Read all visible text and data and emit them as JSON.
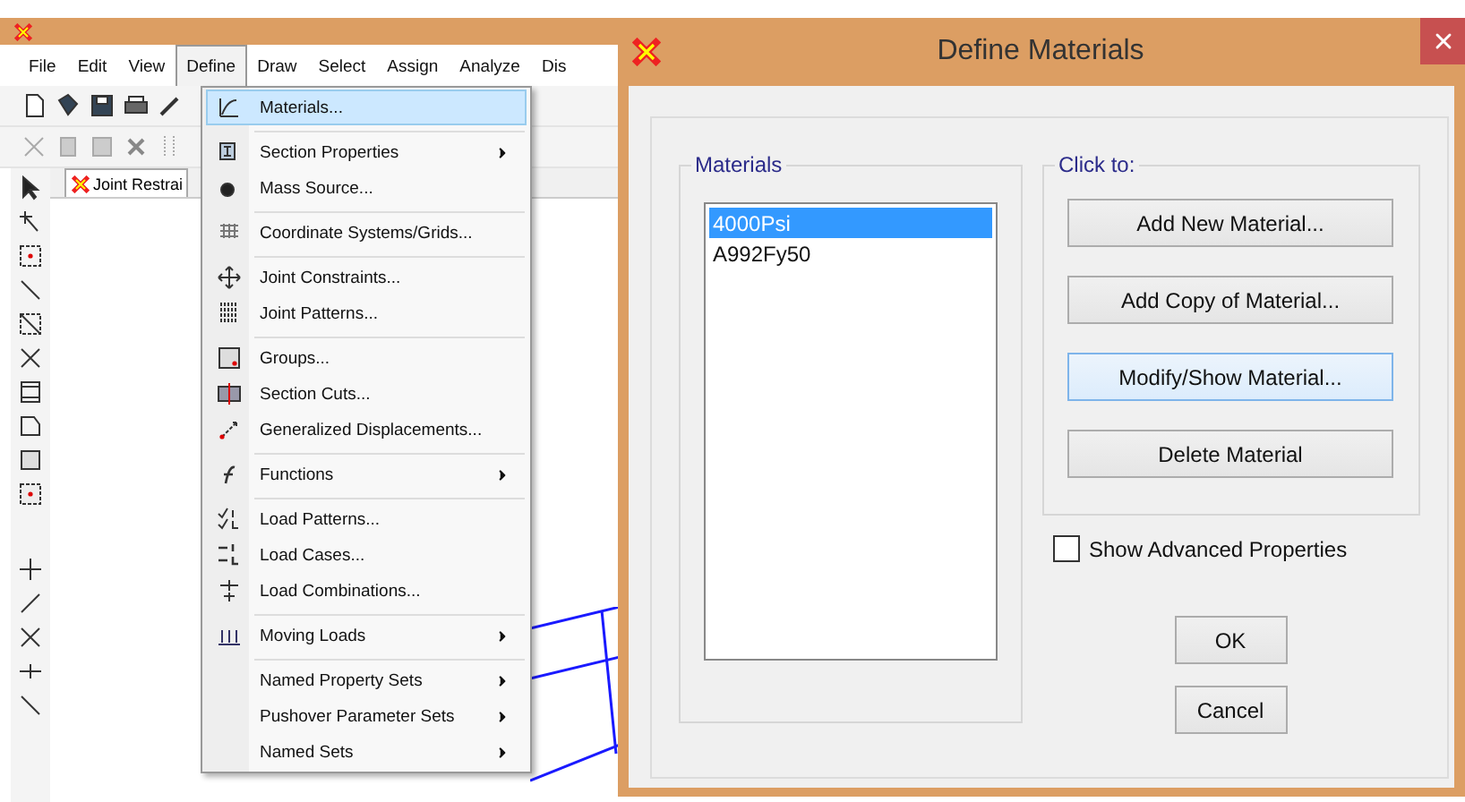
{
  "app": {
    "menu_bar": [
      {
        "label": "File",
        "selected": false
      },
      {
        "label": "Edit",
        "selected": false
      },
      {
        "label": "View",
        "selected": false
      },
      {
        "label": "Define",
        "selected": true
      },
      {
        "label": "Draw",
        "selected": false
      },
      {
        "label": "Select",
        "selected": false
      },
      {
        "label": "Assign",
        "selected": false
      },
      {
        "label": "Analyze",
        "selected": false
      },
      {
        "label": "Dis",
        "selected": false
      }
    ],
    "tab": {
      "label": "Joint Restrai"
    }
  },
  "define_menu": [
    {
      "label": "Materials...",
      "selected": true,
      "submenu": false,
      "separator_before": false
    },
    {
      "label": "Section Properties",
      "selected": false,
      "submenu": true,
      "separator_before": true
    },
    {
      "label": "Mass Source...",
      "selected": false,
      "submenu": false,
      "separator_before": false
    },
    {
      "label": "Coordinate Systems/Grids...",
      "selected": false,
      "submenu": false,
      "separator_before": true
    },
    {
      "label": "Joint Constraints...",
      "selected": false,
      "submenu": false,
      "separator_before": true
    },
    {
      "label": "Joint Patterns...",
      "selected": false,
      "submenu": false,
      "separator_before": false
    },
    {
      "label": "Groups...",
      "selected": false,
      "submenu": false,
      "separator_before": true
    },
    {
      "label": "Section Cuts...",
      "selected": false,
      "submenu": false,
      "separator_before": false
    },
    {
      "label": "Generalized Displacements...",
      "selected": false,
      "submenu": false,
      "separator_before": false
    },
    {
      "label": "Functions",
      "selected": false,
      "submenu": true,
      "separator_before": true
    },
    {
      "label": "Load Patterns...",
      "selected": false,
      "submenu": false,
      "separator_before": true
    },
    {
      "label": "Load Cases...",
      "selected": false,
      "submenu": false,
      "separator_before": false
    },
    {
      "label": "Load Combinations...",
      "selected": false,
      "submenu": false,
      "separator_before": false
    },
    {
      "label": "Moving Loads",
      "selected": false,
      "submenu": true,
      "separator_before": true
    },
    {
      "label": "Named Property Sets",
      "selected": false,
      "submenu": true,
      "separator_before": true
    },
    {
      "label": "Pushover Parameter Sets",
      "selected": false,
      "submenu": true,
      "separator_before": false
    },
    {
      "label": "Named Sets",
      "selected": false,
      "submenu": true,
      "separator_before": false
    }
  ],
  "dialog": {
    "title": "Define Materials",
    "materials_group": {
      "title": "Materials",
      "items": [
        {
          "name": "4000Psi",
          "selected": true
        },
        {
          "name": "A992Fy50",
          "selected": false
        }
      ]
    },
    "actions_group": {
      "title": "Click to:",
      "buttons": [
        {
          "label": "Add New Material...",
          "focused": false
        },
        {
          "label": "Add Copy of Material...",
          "focused": false
        },
        {
          "label": "Modify/Show Material...",
          "focused": true
        },
        {
          "label": "Delete Material",
          "focused": false
        }
      ]
    },
    "advanced": {
      "label": "Show Advanced Properties",
      "checked": false
    },
    "buttons": [
      "OK",
      "Cancel"
    ]
  }
}
